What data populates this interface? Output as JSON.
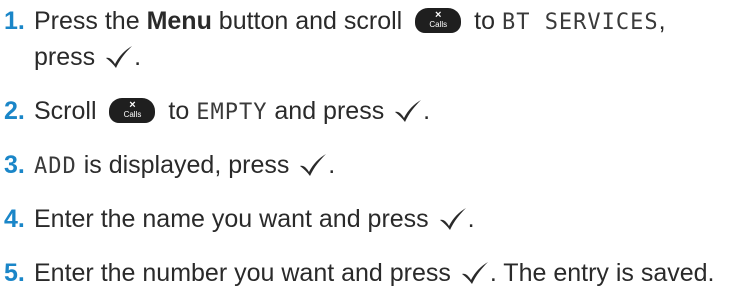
{
  "steps": [
    {
      "number": "1.",
      "line1_part1": "Press the ",
      "bold_word": "Menu",
      "line1_part2": " button and scroll",
      "line1_part3": " to ",
      "display_text": "BT SERVICES",
      "line1_part4": ",",
      "line2_part1": "press ",
      "line2_part2": "."
    },
    {
      "number": "2.",
      "part1": "Scroll",
      "part2": " to ",
      "display_text": "EMPTY",
      "part3": " and press ",
      "part4": "."
    },
    {
      "number": "3.",
      "display_text": "ADD",
      "part1": " is displayed, press ",
      "part2": "."
    },
    {
      "number": "4.",
      "part1": "Enter the name you want and press ",
      "part2": "."
    },
    {
      "number": "5.",
      "part1": "Enter the number you want and press ",
      "part2": ". The entry is saved."
    }
  ],
  "scroll_key": {
    "symbol": "×",
    "label": "Calls"
  },
  "colors": {
    "step_number": "#1a86c8",
    "text": "#2a2a2a",
    "key_background": "#1f1f1f"
  },
  "icons": {
    "scroll_key": "calls-scroll-key-icon",
    "confirm": "check-mark-icon"
  }
}
